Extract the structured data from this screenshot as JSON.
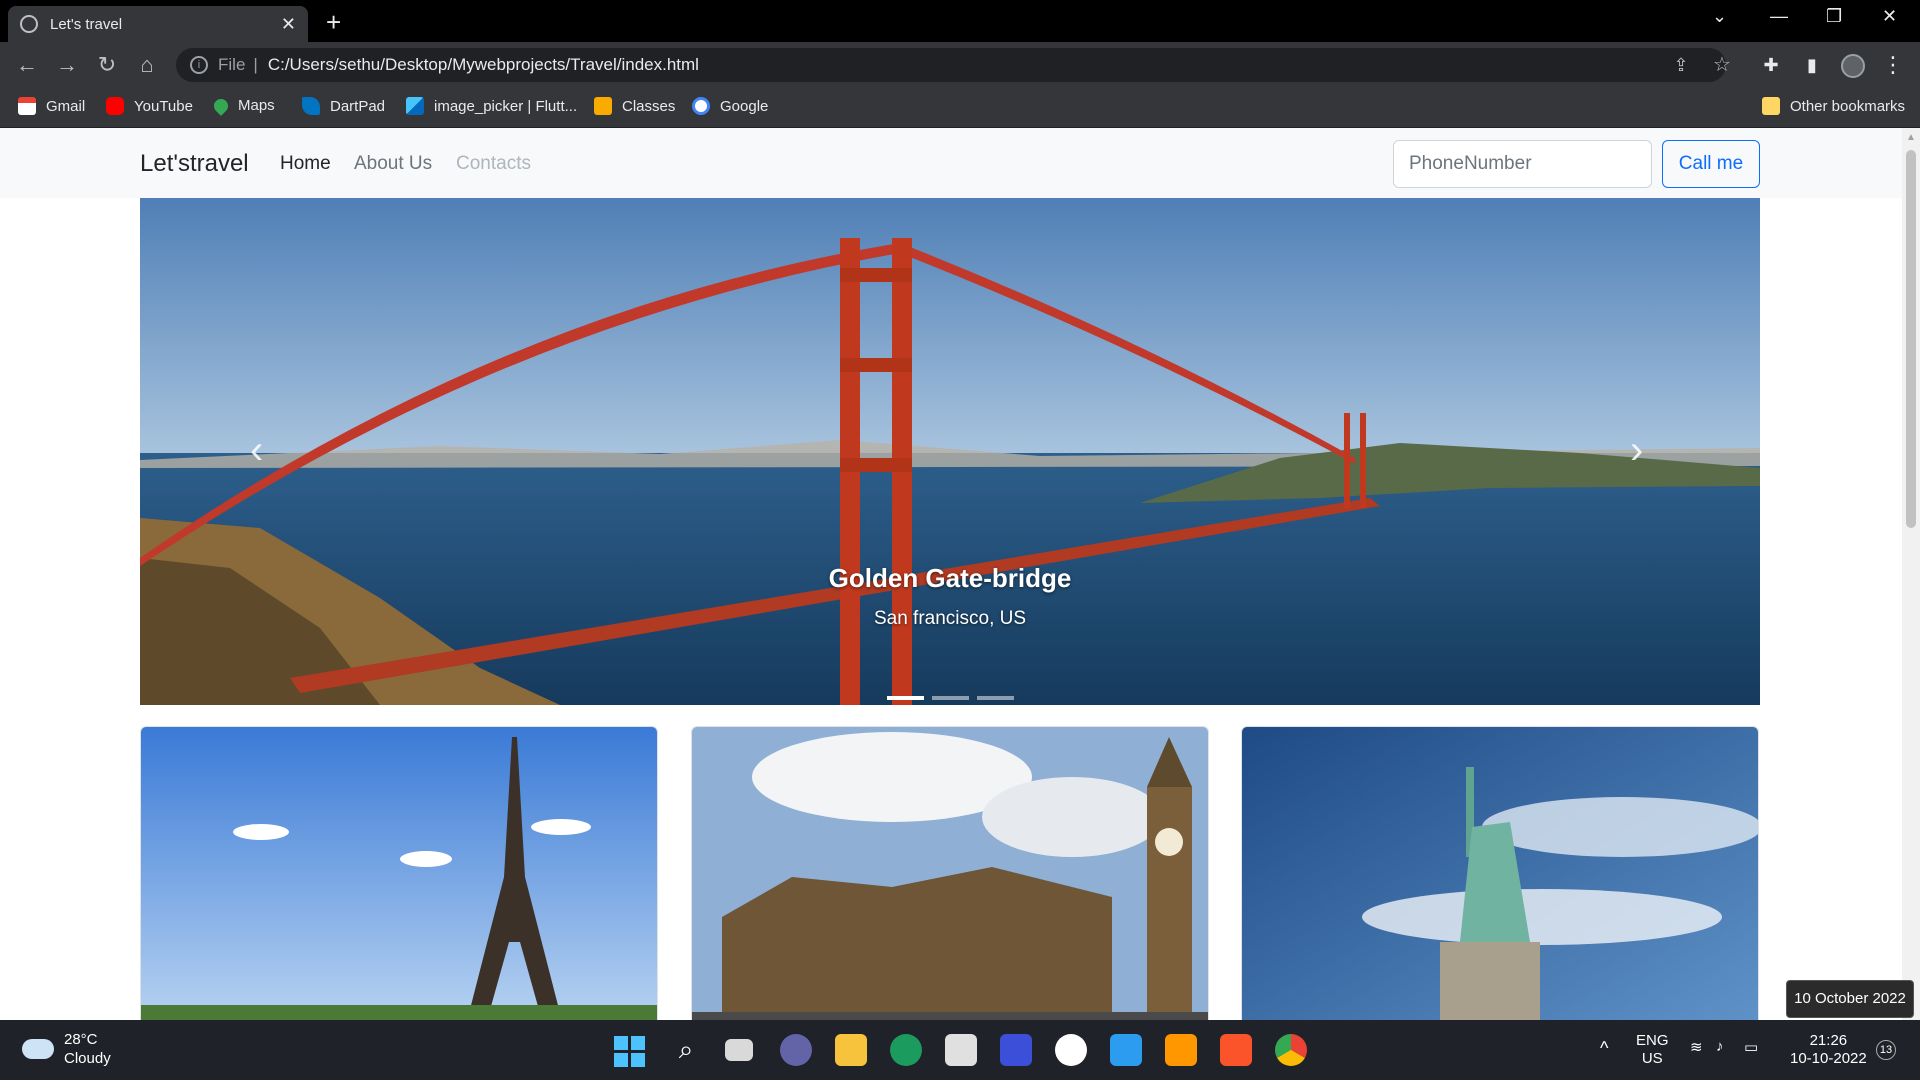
{
  "browser": {
    "tab_title": "Let's travel",
    "address_scheme": "File",
    "address_url": "C:/Users/sethu/Desktop/Mywebprojects/Travel/index.html",
    "bookmarks": [
      "Gmail",
      "YouTube",
      "Maps",
      "DartPad",
      "image_picker | Flutt...",
      "Classes",
      "Google"
    ],
    "other_bookmarks": "Other bookmarks"
  },
  "site": {
    "brand": "Let'stravel",
    "nav": [
      "Home",
      "About Us",
      "Contacts"
    ],
    "phone_placeholder": "PhoneNumber",
    "call_button": "Call me",
    "carousel": {
      "title": "Golden Gate-bridge",
      "subtitle": "San francisco, US",
      "slide_count": 3,
      "active_slide": 1
    },
    "cards": [
      "eiffel-tower-photo",
      "big-ben-photo",
      "statue-of-liberty-photo"
    ]
  },
  "taskbar": {
    "temperature": "28°C",
    "weather": "Cloudy",
    "language": "ENG",
    "region": "US",
    "time": "21:26",
    "date": "10-10-2022",
    "notification_count": "13",
    "date_tooltip": "10 October 2022"
  },
  "colors": {
    "accent": "#0d6efd",
    "navbar_bg": "#f8f9fa",
    "taskbar_bg": "#1f2229"
  }
}
